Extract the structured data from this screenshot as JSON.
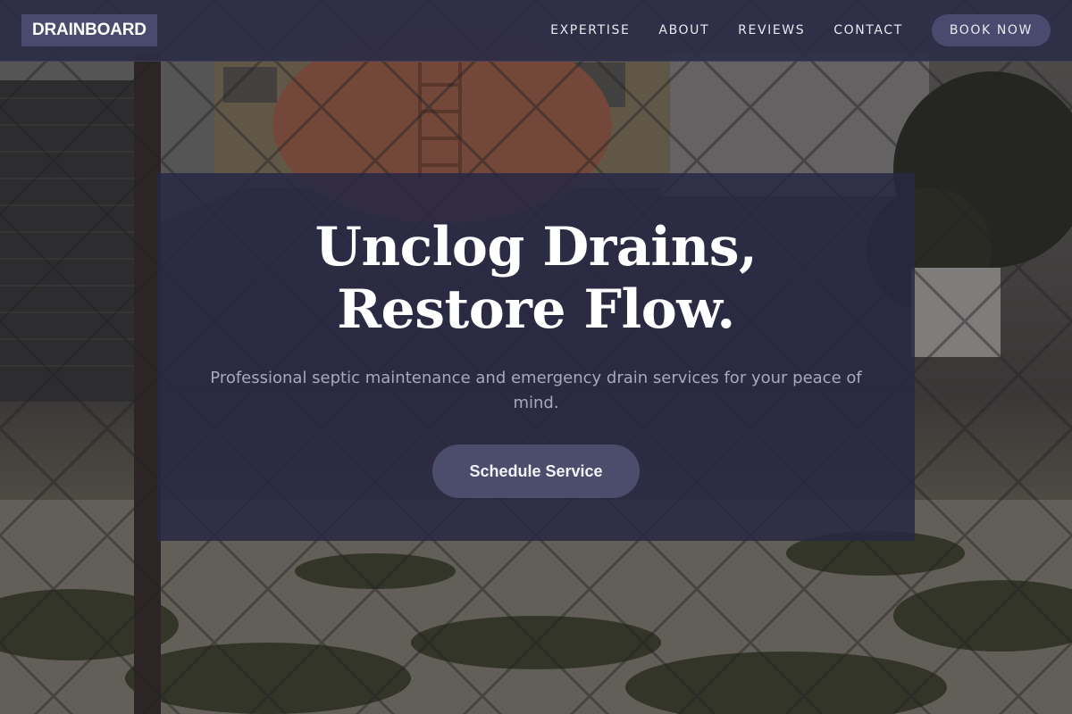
{
  "header": {
    "logo": "DRAINBOARD",
    "nav": [
      {
        "label": "EXPERTISE"
      },
      {
        "label": "ABOUT"
      },
      {
        "label": "REVIEWS"
      },
      {
        "label": "CONTACT"
      }
    ],
    "book_now": "BOOK NOW"
  },
  "hero": {
    "title_line1": "Unclog Drains,",
    "title_line2": "Restore Flow.",
    "subtitle": "Professional septic maintenance and emergency drain services for your peace of mind.",
    "cta": "Schedule Service"
  },
  "colors": {
    "header_bg": "#2c2c48",
    "accent": "#4a4a6e",
    "card_bg": "#28284a",
    "text_light": "#ffffff",
    "subtitle_text": "#a9a9bc"
  }
}
